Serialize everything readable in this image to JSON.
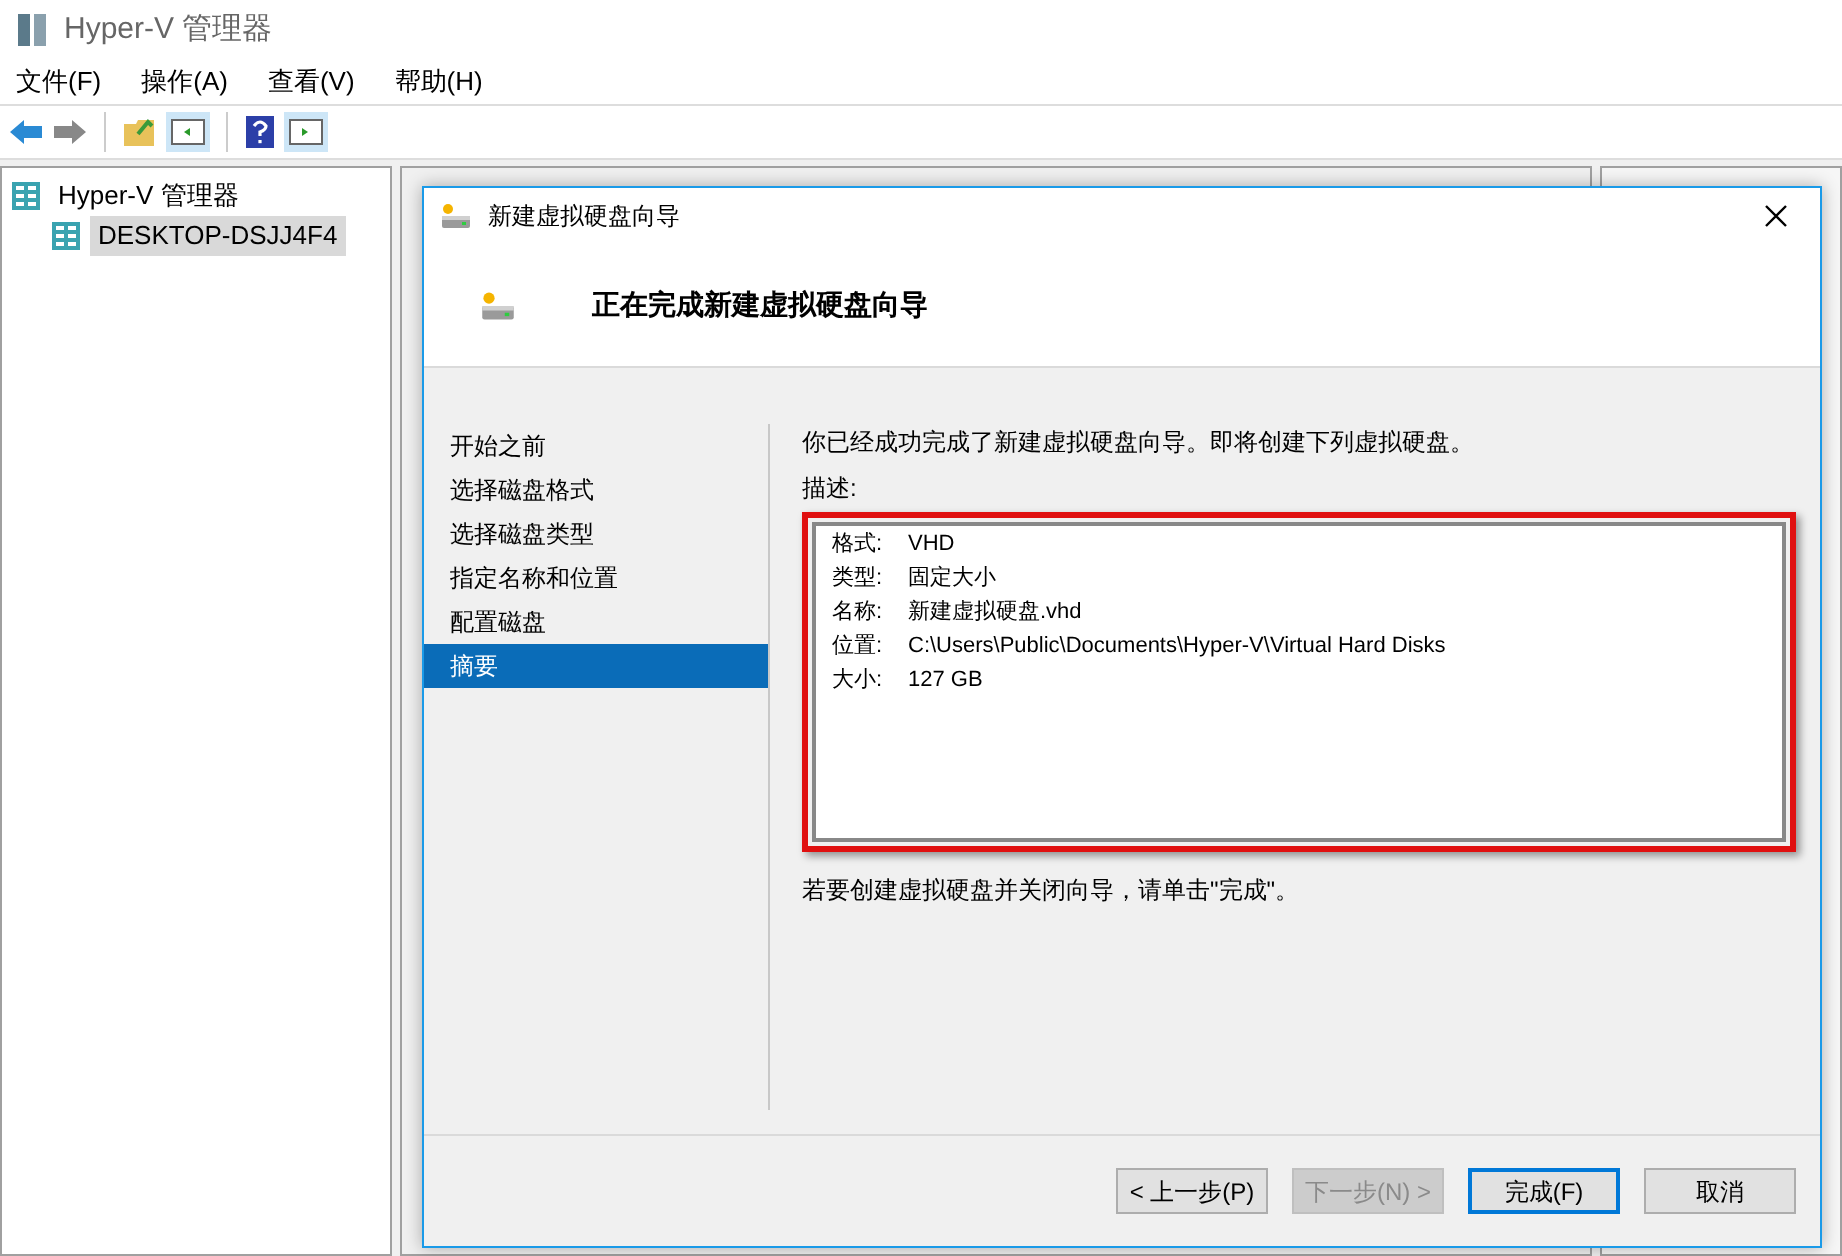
{
  "window": {
    "title": "Hyper-V 管理器"
  },
  "menu": [
    "文件(F)",
    "操作(A)",
    "查看(V)",
    "帮助(H)"
  ],
  "tree": [
    {
      "label": "Hyper-V 管理器",
      "selected": false,
      "children": [
        {
          "label": "DESKTOP-DSJJ4F4",
          "selected": true
        }
      ]
    }
  ],
  "dialog": {
    "title": "新建虚拟硬盘向导",
    "heading": "正在完成新建虚拟硬盘向导",
    "steps": [
      {
        "label": "开始之前",
        "selected": false
      },
      {
        "label": "选择磁盘格式",
        "selected": false
      },
      {
        "label": "选择磁盘类型",
        "selected": false
      },
      {
        "label": "指定名称和位置",
        "selected": false
      },
      {
        "label": "配置磁盘",
        "selected": false
      },
      {
        "label": "摘要",
        "selected": true
      }
    ],
    "intro": "你已经成功完成了新建虚拟硬盘向导。即将创建下列虚拟硬盘。",
    "description_label": "描述:",
    "summary": [
      {
        "label": "格式:",
        "value": "VHD"
      },
      {
        "label": "类型:",
        "value": "固定大小"
      },
      {
        "label": "名称:",
        "value": "新建虚拟硬盘.vhd"
      },
      {
        "label": "位置:",
        "value": "C:\\Users\\Public\\Documents\\Hyper-V\\Virtual Hard Disks"
      },
      {
        "label": "大小:",
        "value": "127 GB"
      }
    ],
    "hint": "若要创建虚拟硬盘并关闭向导，请单击\"完成\"。",
    "buttons": [
      {
        "label": "< 上一步(P)",
        "disabled": false,
        "default": false
      },
      {
        "label": "下一步(N) >",
        "disabled": true,
        "default": false
      },
      {
        "label": "完成(F)",
        "disabled": false,
        "default": true
      },
      {
        "label": "取消",
        "disabled": false,
        "default": false
      }
    ]
  }
}
